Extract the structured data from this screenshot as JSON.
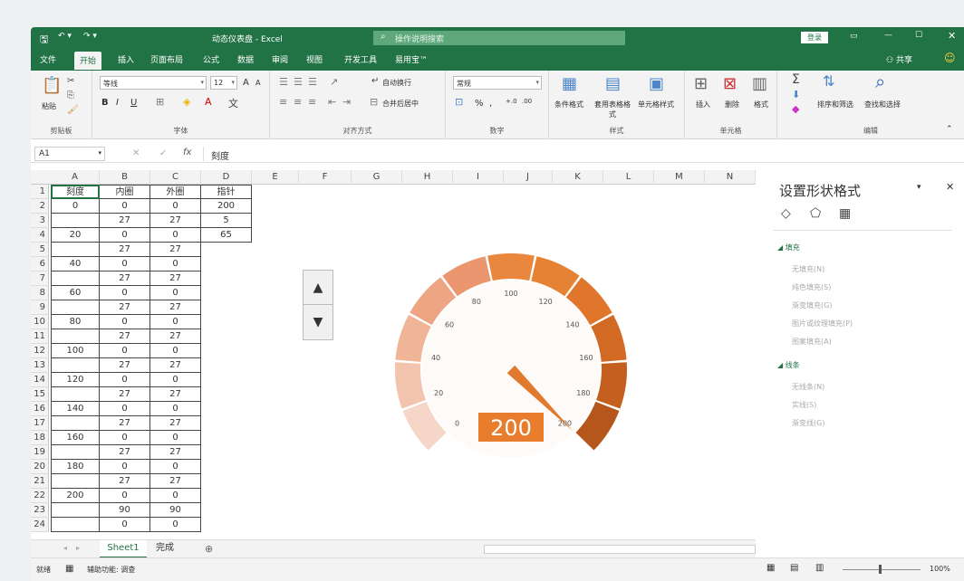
{
  "titlebar": {
    "filename": "动态仪表盘 - Excel",
    "search_placeholder": "操作说明搜索",
    "login": "登录"
  },
  "menu": {
    "tabs": [
      "文件",
      "开始",
      "插入",
      "页面布局",
      "公式",
      "数据",
      "审阅",
      "视图",
      "开发工具",
      "易用宝™"
    ],
    "active": "开始",
    "share": "共享"
  },
  "ribbon": {
    "clipboard": {
      "paste": "粘贴",
      "label": "剪贴板"
    },
    "font": {
      "name": "等线",
      "size": "12",
      "label": "字体",
      "grow": "A",
      "shrink": "A",
      "bold": "B",
      "italic": "I",
      "underline": "U"
    },
    "alignment": {
      "wrap": "自动换行",
      "merge": "合并后居中",
      "label": "对齐方式"
    },
    "number": {
      "format": "常规",
      "percent": "%",
      "comma": ",",
      "label": "数字"
    },
    "styles": {
      "cond": "条件格式",
      "table": "套用表格格式",
      "cell": "单元格样式",
      "label": "样式"
    },
    "cells": {
      "insert": "插入",
      "delete": "删除",
      "format": "格式",
      "label": "单元格"
    },
    "editing": {
      "sort": "排序和筛选",
      "find": "查找和选择",
      "label": "编辑"
    }
  },
  "formula": {
    "namebox": "A1",
    "content": "刻度",
    "fx": "fx"
  },
  "sheet": {
    "columns": [
      "A",
      "B",
      "C",
      "D",
      "E",
      "F",
      "G",
      "H",
      "I",
      "J",
      "K",
      "L",
      "M",
      "N"
    ],
    "rows": [
      "1",
      "2",
      "3",
      "4",
      "5",
      "6",
      "7",
      "8",
      "9",
      "10",
      "11",
      "12",
      "13",
      "14",
      "15",
      "16",
      "17",
      "18",
      "19",
      "20",
      "21",
      "22",
      "23",
      "24"
    ],
    "colA": [
      "刻度",
      "0",
      "",
      "20",
      "",
      "40",
      "",
      "60",
      "",
      "80",
      "",
      "100",
      "",
      "120",
      "",
      "140",
      "",
      "160",
      "",
      "180",
      "",
      "200",
      "",
      ""
    ],
    "colB": [
      "内圈",
      "0",
      "27",
      "0",
      "27",
      "0",
      "27",
      "0",
      "27",
      "0",
      "27",
      "0",
      "27",
      "0",
      "27",
      "0",
      "27",
      "0",
      "27",
      "0",
      "27",
      "0",
      "90",
      "0"
    ],
    "colC": [
      "外圈",
      "0",
      "27",
      "0",
      "27",
      "0",
      "27",
      "0",
      "27",
      "0",
      "27",
      "0",
      "27",
      "0",
      "27",
      "0",
      "27",
      "0",
      "27",
      "0",
      "27",
      "0",
      "90",
      "0"
    ],
    "colD": [
      "指针",
      "200",
      "5",
      "65"
    ]
  },
  "gauge": {
    "value": 200,
    "value_label": "200",
    "ticks": [
      "0",
      "20",
      "40",
      "60",
      "80",
      "100",
      "120",
      "140",
      "160",
      "180",
      "200"
    ],
    "colors": [
      "#f5d6c8",
      "#f2c3ad",
      "#f0b496",
      "#eea584",
      "#ec9670",
      "#e9873f",
      "#e58234",
      "#e0762b",
      "#d26a24",
      "#c45f20",
      "#b5561d"
    ]
  },
  "pane": {
    "title": "设置形状格式",
    "fill_header": "填充",
    "fill_options": [
      "无填充(N)",
      "纯色填充(S)",
      "渐变填充(G)",
      "图片或纹理填充(P)",
      "图案填充(A)"
    ],
    "line_header": "线条",
    "line_options": [
      "无线条(N)",
      "实线(S)",
      "渐变线(G)"
    ]
  },
  "tabs": {
    "sheet1": "Sheet1",
    "done": "完成"
  },
  "status": {
    "ready": "就绪",
    "accessibility": "辅助功能: 调查",
    "zoom": "100%"
  }
}
